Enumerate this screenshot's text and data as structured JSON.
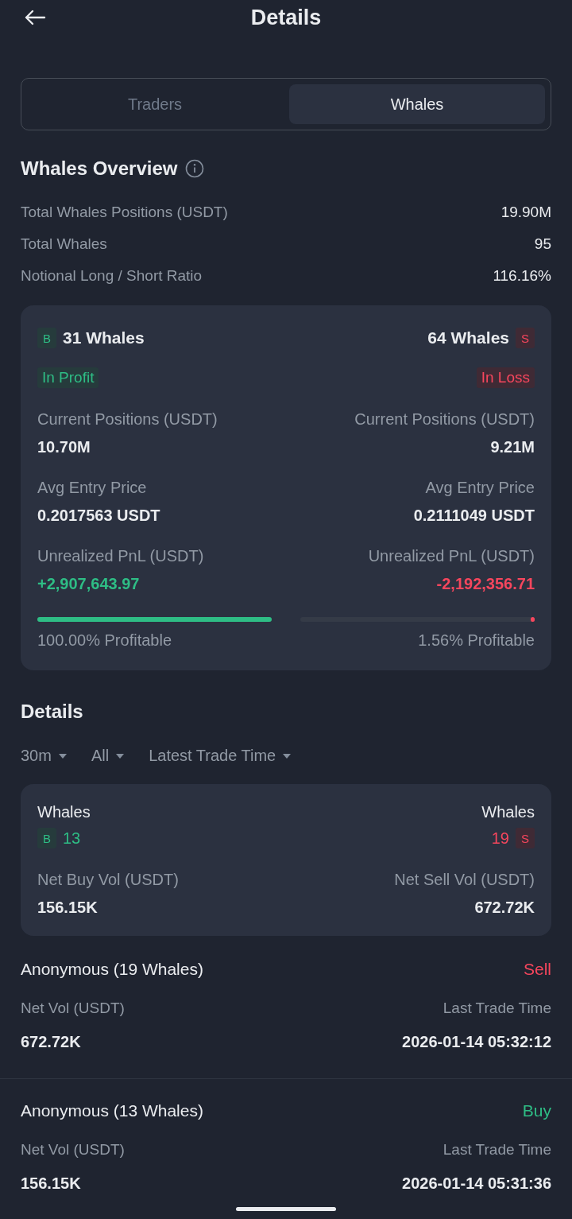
{
  "header": {
    "title": "Details"
  },
  "tabs": [
    {
      "label": "Traders",
      "selected": false
    },
    {
      "label": "Whales",
      "selected": true
    }
  ],
  "overview": {
    "title": "Whales Overview",
    "rows": [
      {
        "label": "Total Whales Positions (USDT)",
        "value": "19.90M"
      },
      {
        "label": "Total Whales",
        "value": "95"
      },
      {
        "label": "Notional Long / Short Ratio",
        "value": "116.16%"
      }
    ]
  },
  "summary": [
    {
      "kind": "buy",
      "badge": "B",
      "count": "31 Whales",
      "status": "In Profit",
      "positions_label": "Current Positions (USDT)",
      "positions": "10.70M",
      "entry_label": "Avg Entry Price",
      "entry": "0.2017563 USDT",
      "pnl_label": "Unrealized PnL (USDT)",
      "pnl": "+2,907,643.97",
      "level": 1.0,
      "profitable": "100.00% Profitable"
    },
    {
      "kind": "sell",
      "badge": "S",
      "count": "64 Whales",
      "status": "In Loss",
      "positions_label": "Current Positions (USDT)",
      "positions": "9.21M",
      "entry_label": "Avg Entry Price",
      "entry": "0.2111049 USDT",
      "pnl_label": "Unrealized PnL (USDT)",
      "pnl": "-2,192,356.71",
      "level": 0.0156,
      "profitable": "1.56% Profitable"
    }
  ],
  "details": {
    "title": "Details",
    "filters": [
      "30m",
      "All",
      "Latest Trade Time"
    ],
    "sides": [
      {
        "kind": "buy",
        "label": "Whales",
        "badge": "B",
        "count": "13",
        "vol_label": "Net Buy Vol (USDT)",
        "vol": "156.15K"
      },
      {
        "kind": "sell",
        "label": "Whales",
        "badge": "S",
        "count": "19",
        "vol_label": "Net Sell Vol (USDT)",
        "vol": "672.72K"
      }
    ]
  },
  "trades": [
    {
      "name": "Anonymous (19 Whales)",
      "kind": "sell",
      "side": "Sell",
      "vol_label": "Net Vol (USDT)",
      "vol": "672.72K",
      "time_label": "Last Trade Time",
      "time": "2026-01-14 05:32:12"
    },
    {
      "name": "Anonymous (13 Whales)",
      "kind": "buy",
      "side": "Buy",
      "vol_label": "Net Vol (USDT)",
      "vol": "156.15K",
      "time_label": "Last Trade Time",
      "time": "2026-01-14 05:31:36"
    }
  ]
}
